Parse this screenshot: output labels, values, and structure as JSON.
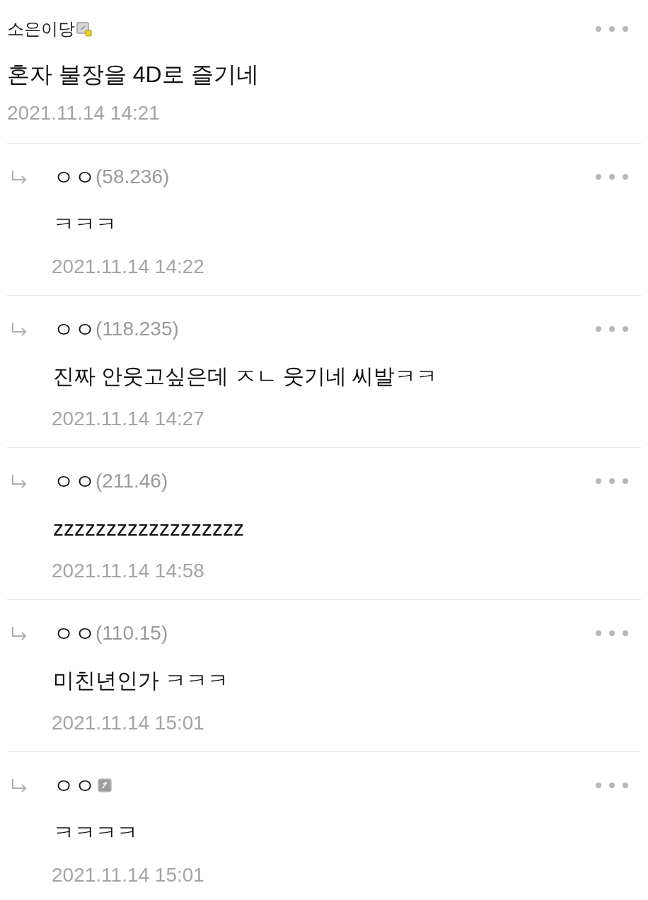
{
  "post": {
    "author": "소은이당",
    "kind": "fixed",
    "text": "혼자 불장을 4D로 즐기네",
    "time": "2021.11.14 14:21"
  },
  "replies": [
    {
      "kind": "guest",
      "author": "ㅇㅇ",
      "ip": "(58.236)",
      "text": "ㅋㅋㅋ",
      "time": "2021.11.14 14:22"
    },
    {
      "kind": "guest",
      "author": "ㅇㅇ",
      "ip": "(118.235)",
      "text": "진짜 안웃고싶은데 ㅈㄴ 웃기네 씨발ㅋㅋ",
      "time": "2021.11.14 14:27"
    },
    {
      "kind": "guest",
      "author": "ㅇㅇ",
      "ip": "(211.46)",
      "text": "zzzzzzzzzzzzzzzzzz",
      "time": "2021.11.14 14:58"
    },
    {
      "kind": "guest",
      "author": "ㅇㅇ",
      "ip": "(110.15)",
      "text": "미친년인가 ㅋㅋㅋ",
      "time": "2021.11.14 15:01"
    },
    {
      "kind": "semi",
      "author": "ㅇㅇ",
      "text": "ㅋㅋㅋㅋ",
      "time": "2021.11.14 15:01"
    }
  ]
}
